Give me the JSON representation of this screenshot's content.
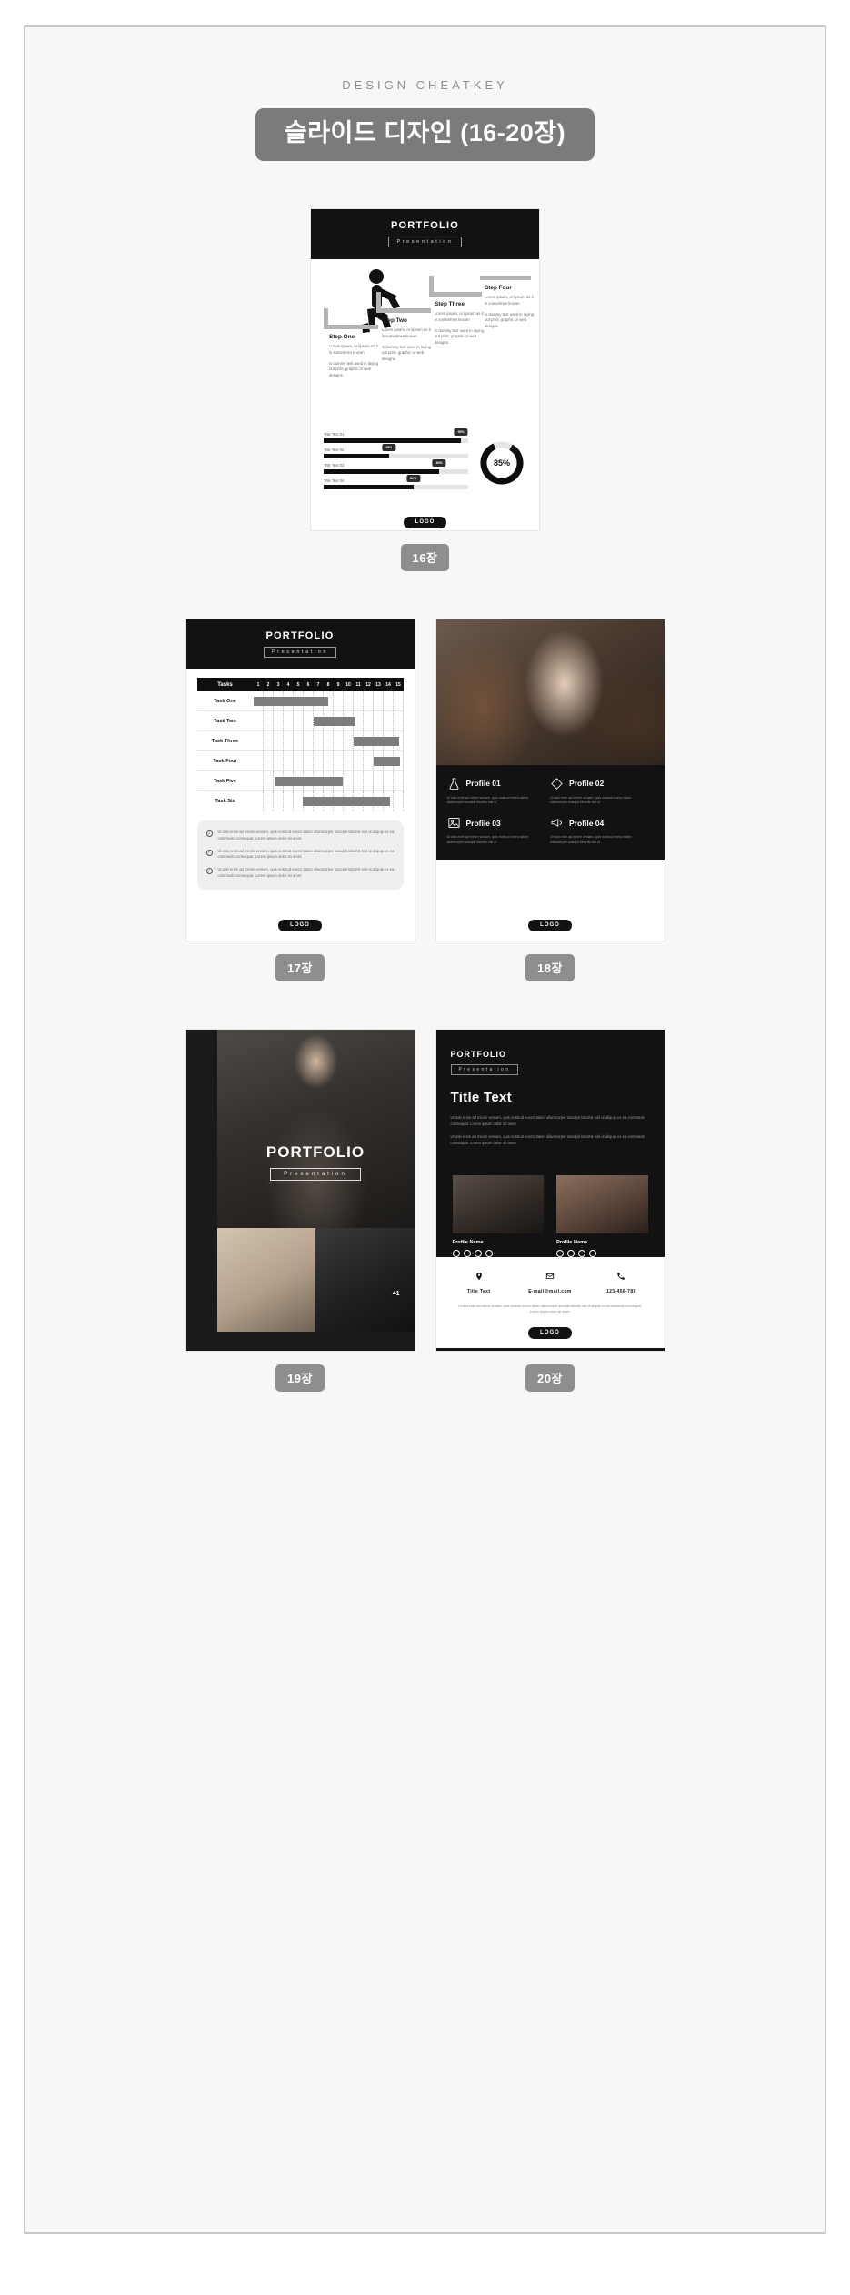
{
  "header": {
    "eyebrow": "DESIGN CHEATKEY",
    "title": "슬라이드 디자인 (16-20장)"
  },
  "brand": {
    "portfolio": "PORTFOLIO",
    "presentation": "Presentation",
    "logo": "LOGO"
  },
  "colors": {
    "pill": "#7b7b7b",
    "dark": "#121212",
    "accent_bar": "#0f0f0f",
    "gantt_bar": "#7d7d7d",
    "page_bg": "#f7f7f7"
  },
  "slides": [
    {
      "page_label": "16장",
      "steps": [
        {
          "heading": "Step One",
          "p1": "Lorem ipsum, or lipsum as it is sometimes known",
          "p2": "is dummy text used in laying out print, graphic or web designs."
        },
        {
          "heading": "Step Two",
          "p1": "Lorem ipsum, or lipsum as it is sometimes known",
          "p2": "is dummy text used in laying out print, graphic or web designs."
        },
        {
          "heading": "Step Three",
          "p1": "Lorem ipsum, or lipsum as it is sometimes known",
          "p2": "is dummy text used in laying out print, graphic or web designs."
        },
        {
          "heading": "Step Four",
          "p1": "Lorem ipsum, or lipsum as it is sometimes known",
          "p2": "is dummy text used in laying out print, graphic or web designs."
        }
      ],
      "bars": [
        {
          "label": "Title Text 01",
          "value": 95,
          "badge": "95%"
        },
        {
          "label": "Title Text 02",
          "value": 45,
          "badge": "45%"
        },
        {
          "label": "Title Text 03",
          "value": 80,
          "badge": "80%"
        },
        {
          "label": "Title Text 04",
          "value": 62,
          "badge": "62%"
        }
      ],
      "donut": {
        "value": 85,
        "label": "85%"
      }
    },
    {
      "page_label": "17장",
      "gantt": {
        "name_header": "Tasks",
        "columns": [
          "1",
          "2",
          "3",
          "4",
          "5",
          "6",
          "7",
          "8",
          "9",
          "10",
          "11",
          "12",
          "13",
          "14",
          "15"
        ],
        "rows": [
          {
            "task": "Task One",
            "start": 1,
            "end": 8
          },
          {
            "task": "Task Two",
            "start": 7,
            "end": 11
          },
          {
            "task": "Task Three",
            "start": 11,
            "end": 15
          },
          {
            "task": "Task Four",
            "start": 13,
            "end": 15
          },
          {
            "task": "Task Five",
            "start": 3,
            "end": 10
          },
          {
            "task": "Task Six",
            "start": 6,
            "end": 14
          }
        ]
      },
      "checklist": [
        "Ut wisi enim ad minim veniam, quis nostrud exerci tation ullamcorper suscipit lobortis nisl ut aliquip ex ea commodo consequat. Lorem ipsum dolor sit amet.",
        "Ut wisi enim ad minim veniam, quis nostrud exerci tation ullamcorper suscipit lobortis nisl ut aliquip ex ea commodo consequat. Lorem ipsum dolor sit amet.",
        "Ut wisi enim ad minim veniam, quis nostrud exerci tation ullamcorper suscipit lobortis nisl ut aliquip ex ea commodo consequat. Lorem ipsum dolor sit amet."
      ]
    },
    {
      "page_label": "18장",
      "profiles": [
        {
          "name": "Profile 01",
          "icon": "flask-icon",
          "text": "Ut wisi enim ad minim veniam, quis nostrud exerci tation ullamcorper suscipit lobortis nisl ut"
        },
        {
          "name": "Profile 02",
          "icon": "diamond-icon",
          "text": "Ut wisi enim ad minim veniam, quis nostrud exerci tation ullamcorper suscipit lobortis nisl ut"
        },
        {
          "name": "Profile 03",
          "icon": "image-icon",
          "text": "Ut wisi enim ad minim veniam, quis nostrud exerci tation ullamcorper suscipit lobortis nisl ut"
        },
        {
          "name": "Profile 04",
          "icon": "megaphone-icon",
          "text": "Ut wisi enim ad minim veniam, quis nostrud exerci tation ullamcorper suscipit lobortis nisl ut"
        }
      ]
    },
    {
      "page_label": "19장",
      "hero_title": "PORTFOLIO",
      "hero_sub": "Presentation",
      "thumb_badge": "41"
    },
    {
      "page_label": "20장",
      "title": "Title Text",
      "paragraphs": [
        "Ut wisi enim ad minim veniam, quis nostrud exerci tation ullamcorper suscipit lobortis nisl ut aliquip ex ea commodo consequat. Lorem ipsum dolor sit amet.",
        "Ut wisi enim ad minim veniam, quis nostrud exerci tation ullamcorper suscipit lobortis nisl ut aliquip ex ea commodo consequat. Lorem ipsum dolor sit amet."
      ],
      "cards": [
        {
          "name": "Profile Name",
          "socials": [
            "twitter-icon",
            "instagram-icon",
            "linkedin-icon",
            "mail-icon"
          ]
        },
        {
          "name": "Profile Name",
          "socials": [
            "twitter-icon",
            "instagram-icon",
            "linkedin-icon",
            "mail-icon"
          ]
        }
      ],
      "contacts": [
        {
          "icon": "location-icon",
          "label": "Title Text"
        },
        {
          "icon": "mail-icon",
          "label": "E-mail@mail.com"
        },
        {
          "icon": "phone-icon",
          "label": "123-456-789"
        }
      ],
      "footer_text": "Ut wisi enim ad minim veniam, quis nostrud exerci tation ullamcorper suscipit lobortis nisl ut aliquip ex ea commodo consequat. Lorem ipsum dolor sit amet."
    }
  ]
}
